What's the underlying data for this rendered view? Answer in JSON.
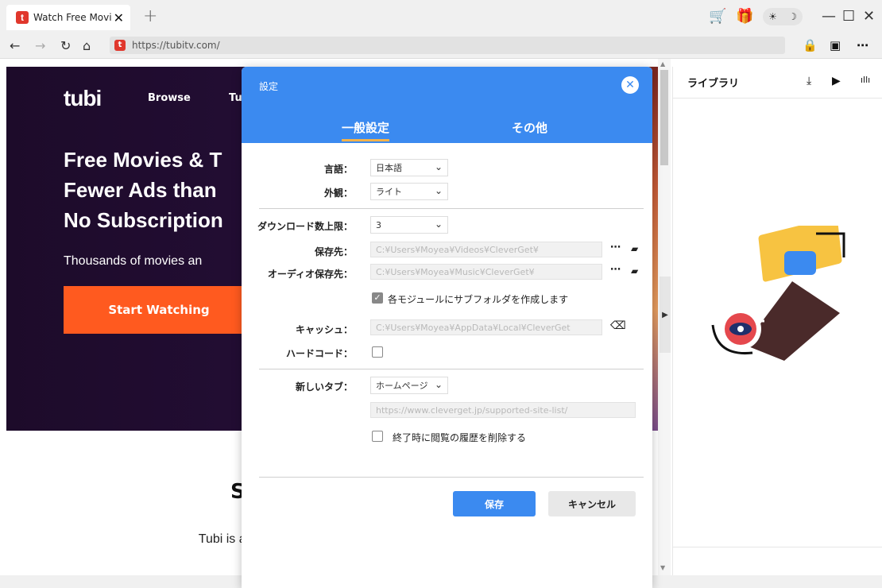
{
  "browser": {
    "tab_title": "Watch Free Movi",
    "tab_close": "✕",
    "new_tab": "+",
    "url": "https://tubitv.com/",
    "favicon_letter": "t"
  },
  "webpage": {
    "logo": "tubi",
    "nav": [
      "Browse",
      "Tu"
    ],
    "headline": "Free Movies & T\nFewer Ads than \nNo Subscription",
    "subline": "Thousands of movies an",
    "start_button": "Start Watching",
    "below_title": "S",
    "below_text": "Tubi is available for free on Android, iOS, Roku, Apple TV, Amazon Fire"
  },
  "library": {
    "title": "ライブラリ"
  },
  "settings": {
    "title": "設定",
    "tabs": [
      "一般設定",
      "その他"
    ],
    "language_label": "言語：",
    "language_value": "日本語",
    "appearance_label": "外観：",
    "appearance_value": "ライト",
    "download_limit_label": "ダウンロード数上限：",
    "download_limit_value": "3",
    "save_path_label": "保存先：",
    "save_path_value": "C:¥Users¥Moyea¥Videos¥CleverGet¥",
    "audio_path_label": "オーディオ保存先：",
    "audio_path_value": "C:¥Users¥Moyea¥Music¥CleverGet¥",
    "subfolder_label": "各モジュールにサブフォルダを作成します",
    "subfolder_checked": true,
    "cache_label": "キャッシュ：",
    "cache_value": "C:¥Users¥Moyea¥AppData¥Local¥CleverGet",
    "hardcode_label": "ハードコード：",
    "hardcode_checked": false,
    "new_tab_label": "新しいタブ：",
    "new_tab_value": "ホームページ",
    "new_tab_url": "https://www.cleverget.jp/supported-site-list/",
    "clear_history_label": "終了時に閲覧の履歴を削除する",
    "clear_history_checked": false,
    "save_button": "保存",
    "cancel_button": "キャンセル"
  },
  "colors": {
    "accent": "#3b8af0",
    "tab_underline": "#f3b24b",
    "start_button": "#ff5a1f"
  }
}
